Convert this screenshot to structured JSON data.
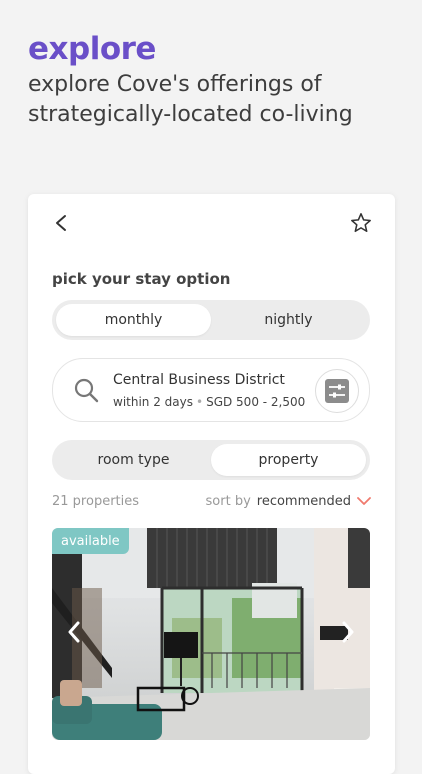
{
  "hero": {
    "title": "explore",
    "subtitle_line1": "explore Cove's offerings of",
    "subtitle_line2": "strategically-located co-living"
  },
  "card": {
    "section_title": "pick your stay option",
    "stay_options": [
      {
        "label": "monthly",
        "selected": true
      },
      {
        "label": "nightly",
        "selected": false
      }
    ],
    "search": {
      "location": "Central Business District",
      "availability": "within 2 days",
      "price_range": "SGD 500 - 2,500"
    },
    "view_options": [
      {
        "label": "room type",
        "selected": false
      },
      {
        "label": "property",
        "selected": true
      }
    ],
    "results_count": "21 properties",
    "sort": {
      "prefix": "sort by",
      "value": "recommended"
    },
    "listing": {
      "badge": "available"
    }
  },
  "colors": {
    "accent_purple": "#6a4fc8",
    "badge_teal": "#7fc7c4",
    "sort_chevron": "#f07a6e",
    "background": "#f3f3f3"
  },
  "icons": [
    "back-arrow-icon",
    "star-icon",
    "search-icon",
    "filter-sliders-icon",
    "chevron-down-icon",
    "chevron-left-icon",
    "chevron-right-icon"
  ]
}
